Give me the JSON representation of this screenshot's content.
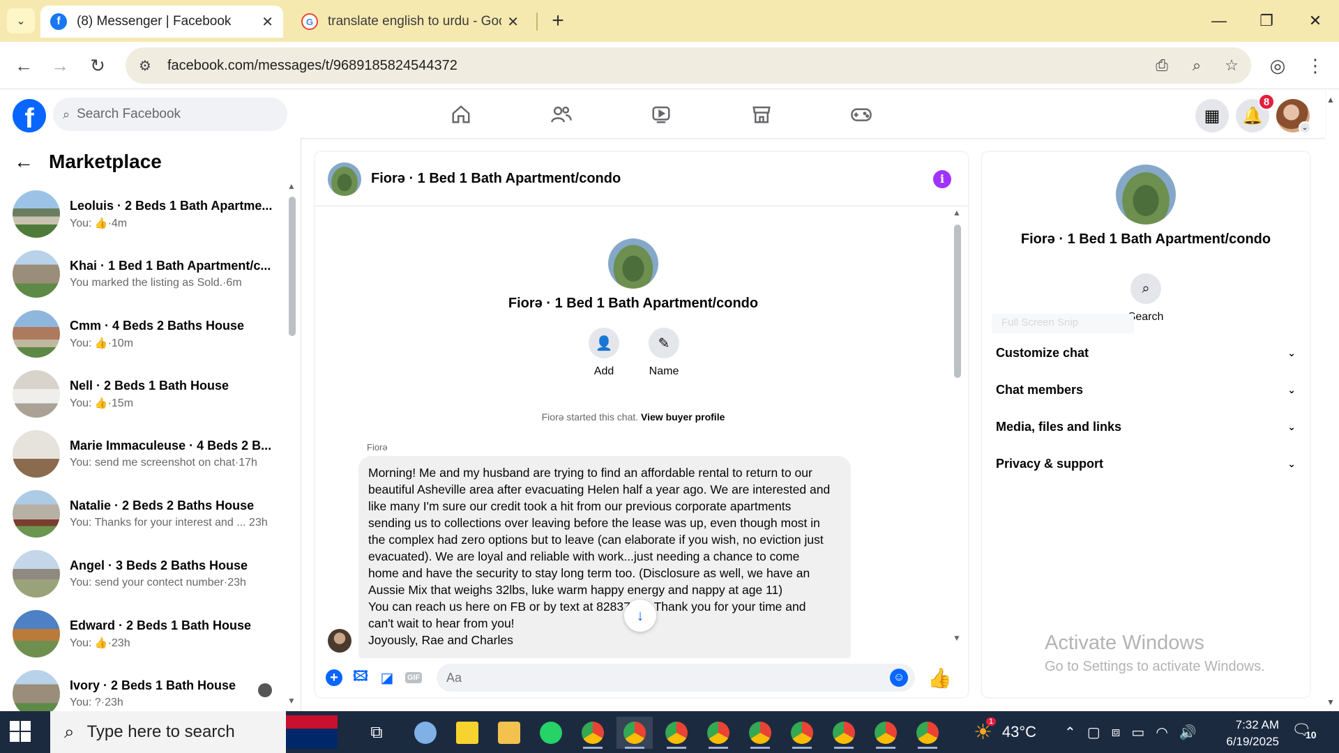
{
  "browser": {
    "tabs": [
      {
        "title": "(8) Messenger | Facebook",
        "icon": "facebook-icon"
      },
      {
        "title": "translate english to urdu - Goo",
        "icon": "google-icon"
      }
    ],
    "url": "facebook.com/messages/t/9689185824544372"
  },
  "fb": {
    "search_placeholder": "Search Facebook",
    "notification_count": "8",
    "colors": {
      "brand": "#0866ff",
      "badge": "#e41e3f",
      "info": "#a033ff"
    }
  },
  "sidebar": {
    "title": "Marketplace",
    "conversations": [
      {
        "name": "Leoluis · 2 Beds 1 Bath Apartme...",
        "prefix": "You: ",
        "preview": "",
        "like": true,
        "time": "·4m"
      },
      {
        "name": "Khai · 1 Bed 1 Bath Apartment/c...",
        "prefix": "",
        "preview": "You marked the listing as Sold.",
        "like": false,
        "time": "·6m"
      },
      {
        "name": "Cmm · 4 Beds 2 Baths House",
        "prefix": "You: ",
        "preview": "",
        "like": true,
        "time": "·10m"
      },
      {
        "name": "Nell · 2 Beds 1 Bath House",
        "prefix": "You: ",
        "preview": "",
        "like": true,
        "time": "·15m"
      },
      {
        "name": "Marie Immaculeuse · 4 Beds 2 B...",
        "prefix": "",
        "preview": "You: send me screenshot on chat",
        "like": false,
        "time": "·17h"
      },
      {
        "name": "Natalie · 2 Beds 2 Baths House",
        "prefix": "",
        "preview": "You: Thanks for your interest and ...",
        "like": false,
        "time": " 23h"
      },
      {
        "name": "Angel · 3 Beds 2 Baths House",
        "prefix": "",
        "preview": "You: send your contect number",
        "like": false,
        "time": "·23h"
      },
      {
        "name": "Edward · 2 Beds 1 Bath House",
        "prefix": "You: ",
        "preview": "",
        "like": true,
        "time": "·23h"
      },
      {
        "name": "Ivory · 2 Beds 1 Bath House",
        "prefix": "",
        "preview": "You: ?",
        "like": false,
        "time": "·23h"
      }
    ]
  },
  "chat": {
    "title": "Fiorə · 1 Bed 1 Bath Apartment/condo",
    "actions": {
      "add": "Add",
      "name": "Name"
    },
    "started": "Fiorə started this chat.",
    "view_profile": "View buyer profile",
    "sender": "Fiorə",
    "message_lines": [
      "Morning! Me and my husband are trying to find an affordable rental to return to our",
      "beautiful Asheville area after evacuating Helen half a year ago. We are interested and",
      "like many I'm sure our credit took a hit from our previous corporate apartments",
      "sending us to collections over leaving before the lease was up, even though most in",
      "the complex had zero options but to leave (can elaborate if you wish, no eviction just",
      "evacuated). We are loyal and reliable with work...just needing a chance to come",
      "home and have the security to stay long term too. (Disclosure as well, we have an",
      "Aussie Mix that weighs 32lbs, luke warm happy energy and nappy at age 11)",
      "You can reach us here on FB or by text at 82837   07. Thank you for your time and",
      "can't wait to hear from you!",
      "Joyously, Rae and Charles"
    ],
    "composer_placeholder": "Aa"
  },
  "rightpanel": {
    "title": "Fiorə · 1 Bed 1 Bath Apartment/condo",
    "search_label": "Search",
    "ghost_text": "Full Screen Snip",
    "sections": [
      "Customize chat",
      "Chat members",
      "Media, files and links",
      "Privacy & support"
    ]
  },
  "watermark": {
    "line1": "Activate Windows",
    "line2": "Go to Settings to activate Windows."
  },
  "taskbar": {
    "search_placeholder": "Type here to search",
    "weather": "43°C",
    "weather_badge": "1",
    "time": "7:32 AM",
    "date": "6/19/2025",
    "notif_count": "10"
  }
}
